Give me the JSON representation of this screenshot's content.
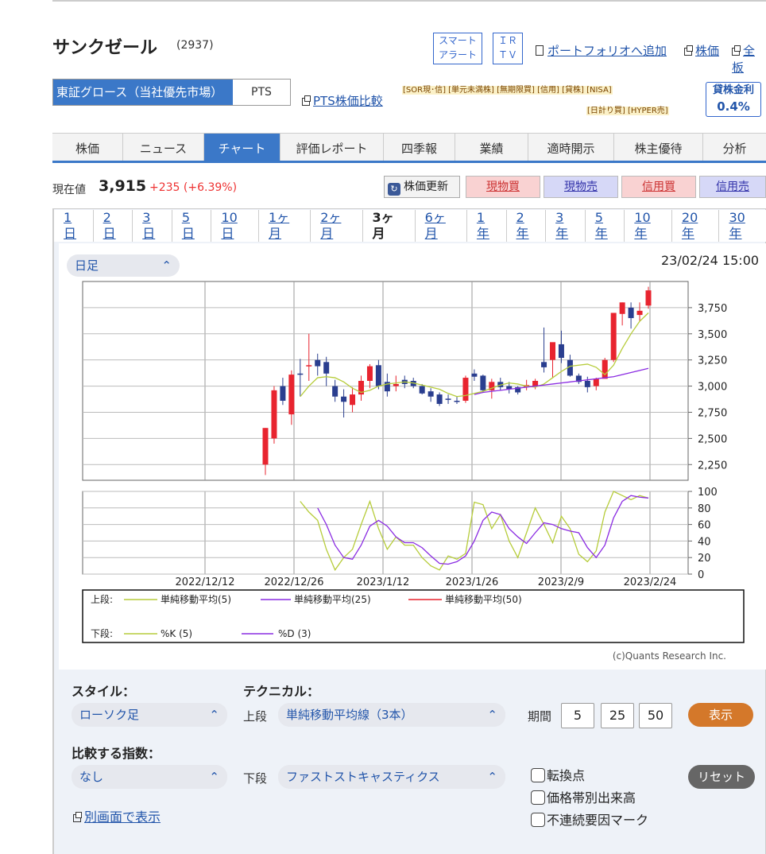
{
  "stock": {
    "name": "サンクゼール",
    "code": "(2937)"
  },
  "top_buttons": {
    "smart_alert_l1": "スマート",
    "smart_alert_l2": "アラート",
    "ir_l1": "ＩＲ",
    "ir_l2": "ＴＶ"
  },
  "top_links": {
    "portfolio": "ポートフォリオへ追加",
    "stock_price": "株価",
    "all": "全板"
  },
  "market": {
    "main": "東証グロース（当社優先市場）",
    "pts": "PTS",
    "pts_compare": "PTS株価比較"
  },
  "tags_line1": "[SOR現･信] [単元未満株] [無期限買] [信用] [貸株] [NISA]",
  "tags_line2": "[日計り買] [HYPER売]",
  "lending": {
    "label": "貸株金利",
    "value": "0.4%"
  },
  "nav": [
    "株価",
    "ニュース",
    "チャート",
    "評価レポート",
    "四季報",
    "業績",
    "適時開示",
    "株主優待",
    "分析"
  ],
  "nav_active": "チャート",
  "price": {
    "label": "現在値",
    "value": "3,915",
    "change": "+235 (+6.39%)"
  },
  "update_btn": "株価更新",
  "trade": {
    "spot_buy": "現物買",
    "spot_sell": "現物売",
    "margin_buy": "信用買",
    "margin_sell": "信用売"
  },
  "colors": {
    "spot_buy_bg": "#f9d2d2",
    "spot_sell_bg": "#d6d8f7",
    "margin_buy_bg": "#f9d2d2",
    "margin_sell_bg": "#d6d8f7",
    "up": "#e8242f",
    "down": "#2a3e8f",
    "accent": "#3b78c8"
  },
  "ranges": [
    "1日",
    "2日",
    "3日",
    "5日",
    "10日",
    "1ヶ月",
    "2ヶ月",
    "3ヶ月",
    "6ヶ月",
    "1年",
    "2年",
    "3年",
    "5年",
    "10年",
    "20年",
    "30年"
  ],
  "range_selected": "3ヶ月",
  "interval": "日足",
  "timestamp": "23/02/24 15:00",
  "legend": {
    "upper": "上段:",
    "lower": "下段:",
    "ma5": "単純移動平均(5)",
    "ma25": "単純移動平均(25)",
    "ma50": "単純移動平均(50)",
    "k": "%K (5)",
    "d": "%D (3)"
  },
  "credit": "(c)Quants Research Inc.",
  "controls": {
    "style_label": "スタイル：",
    "style_value": "ローソク足",
    "technical_label": "テクニカル：",
    "upper_label": "上段",
    "upper_value": "単純移動平均線（3本）",
    "period_label": "期間",
    "periods": [
      "5",
      "25",
      "50"
    ],
    "show": "表示",
    "compare_label": "比較する指数：",
    "compare_value": "なし",
    "lower_label": "下段",
    "lower_value": "ファストストキャスティクス",
    "checks": [
      "転換点",
      "価格帯別出来高",
      "不連続要因マーク"
    ],
    "reset": "リセット",
    "popout": "別画面で表示"
  },
  "chart_data": {
    "type": "candlestick",
    "x": [
      "2022/12/20",
      "2022/12/21",
      "2022/12/22",
      "2022/12/23",
      "2022/12/26",
      "2022/12/27",
      "2022/12/28",
      "2022/12/29",
      "2022/12/30",
      "2023/1/4",
      "2023/1/5",
      "2023/1/6",
      "2023/1/10",
      "2023/1/11",
      "2023/1/12",
      "2023/1/13",
      "2023/1/16",
      "2023/1/17",
      "2023/1/18",
      "2023/1/19",
      "2023/1/20",
      "2023/1/23",
      "2023/1/24",
      "2023/1/25",
      "2023/1/26",
      "2023/1/27",
      "2023/1/30",
      "2023/1/31",
      "2023/2/1",
      "2023/2/2",
      "2023/2/3",
      "2023/2/6",
      "2023/2/7",
      "2023/2/8",
      "2023/2/9",
      "2023/2/10",
      "2023/2/13",
      "2023/2/14",
      "2023/2/15",
      "2023/2/16",
      "2023/2/17",
      "2023/2/20",
      "2023/2/21",
      "2023/2/22",
      "2023/2/24"
    ],
    "xticks": [
      "2022/12/12",
      "2022/12/26",
      "2023/1/12",
      "2023/1/26",
      "2023/2/9",
      "2023/2/24"
    ],
    "ohlc": [
      [
        2250,
        2600,
        2150,
        2600
      ],
      [
        2500,
        3000,
        2450,
        2960
      ],
      [
        3000,
        3080,
        2820,
        2860
      ],
      [
        2730,
        3150,
        2630,
        3110
      ],
      [
        3120,
        3260,
        2900,
        3110
      ],
      [
        3200,
        3500,
        3050,
        3200
      ],
      [
        3250,
        3310,
        3100,
        3190
      ],
      [
        3230,
        3280,
        3000,
        3120
      ],
      [
        3000,
        3060,
        2850,
        2900
      ],
      [
        2900,
        2970,
        2700,
        2850
      ],
      [
        2820,
        2990,
        2750,
        2920
      ],
      [
        2920,
        3100,
        2860,
        3050
      ],
      [
        3050,
        3210,
        2980,
        3190
      ],
      [
        3200,
        3250,
        2970,
        3000
      ],
      [
        3040,
        3120,
        2900,
        2950
      ],
      [
        3000,
        3100,
        2950,
        3020
      ],
      [
        3060,
        3100,
        2980,
        3020
      ],
      [
        3050,
        3080,
        2980,
        3000
      ],
      [
        3000,
        3020,
        2920,
        2930
      ],
      [
        2950,
        2980,
        2850,
        2900
      ],
      [
        2920,
        2940,
        2810,
        2830
      ],
      [
        2880,
        2920,
        2830,
        2870
      ],
      [
        2860,
        2900,
        2830,
        2850
      ],
      [
        2860,
        3100,
        2840,
        3080
      ],
      [
        3120,
        3160,
        3050,
        3090
      ],
      [
        3100,
        3110,
        2940,
        2960
      ],
      [
        2960,
        3070,
        2880,
        3040
      ],
      [
        3040,
        3080,
        2960,
        2990
      ],
      [
        3000,
        3040,
        2930,
        2970
      ],
      [
        2990,
        3000,
        2920,
        2940
      ],
      [
        2990,
        3060,
        2960,
        3010
      ],
      [
        3000,
        3070,
        2970,
        3050
      ],
      [
        3230,
        3560,
        3130,
        3180
      ],
      [
        3250,
        3400,
        3080,
        3420
      ],
      [
        3400,
        3530,
        3220,
        3270
      ],
      [
        3250,
        3300,
        3090,
        3100
      ],
      [
        3100,
        3120,
        3020,
        3040
      ],
      [
        3050,
        3090,
        2940,
        2990
      ],
      [
        3000,
        3080,
        2960,
        3070
      ],
      [
        3070,
        3270,
        3080,
        3250
      ],
      [
        3250,
        3670,
        3230,
        3700
      ],
      [
        3690,
        3800,
        3580,
        3800
      ],
      [
        3750,
        3800,
        3550,
        3650
      ],
      [
        3680,
        3800,
        3620,
        3720
      ],
      [
        3770,
        3950,
        3740,
        3915
      ]
    ],
    "ma5": [
      null,
      null,
      null,
      null,
      2900,
      3000,
      3080,
      3090,
      3080,
      3040,
      2980,
      2940,
      2960,
      3000,
      3020,
      3030,
      3040,
      3030,
      3010,
      2990,
      2970,
      2930,
      2900,
      2910,
      2930,
      2950,
      2980,
      3010,
      3030,
      3020,
      3000,
      2990,
      3020,
      3080,
      3140,
      3190,
      3200,
      3210,
      3180,
      3110,
      3200,
      3360,
      3500,
      3620,
      3700
    ],
    "ma25": [
      null,
      null,
      null,
      null,
      null,
      null,
      null,
      null,
      null,
      null,
      null,
      null,
      null,
      null,
      null,
      null,
      null,
      null,
      null,
      null,
      null,
      null,
      null,
      null,
      2920,
      2940,
      2950,
      2960,
      2970,
      2980,
      2990,
      3000,
      3010,
      3020,
      3030,
      3040,
      3050,
      3060,
      3070,
      3080,
      3090,
      3110,
      3130,
      3150,
      3170
    ],
    "k": [
      null,
      null,
      null,
      null,
      88,
      75,
      65,
      30,
      5,
      20,
      30,
      60,
      88,
      55,
      30,
      45,
      35,
      35,
      20,
      10,
      5,
      22,
      18,
      25,
      87,
      84,
      55,
      72,
      40,
      20,
      50,
      80,
      60,
      38,
      70,
      55,
      24,
      15,
      28,
      75,
      100,
      95,
      90,
      95,
      92
    ],
    "d": [
      null,
      null,
      null,
      null,
      null,
      null,
      80,
      60,
      35,
      20,
      18,
      35,
      58,
      65,
      58,
      45,
      38,
      38,
      32,
      22,
      13,
      12,
      15,
      22,
      40,
      65,
      75,
      72,
      55,
      45,
      37,
      50,
      62,
      60,
      55,
      52,
      50,
      32,
      20,
      35,
      68,
      88,
      95,
      93,
      92
    ],
    "ylim_upper": [
      2100,
      4000
    ],
    "yticks_upper": [
      2250,
      2500,
      2750,
      3000,
      3250,
      3500,
      3750
    ],
    "ylim_lower": [
      0,
      100
    ],
    "yticks_lower": [
      0,
      20,
      40,
      60,
      80,
      100
    ]
  }
}
